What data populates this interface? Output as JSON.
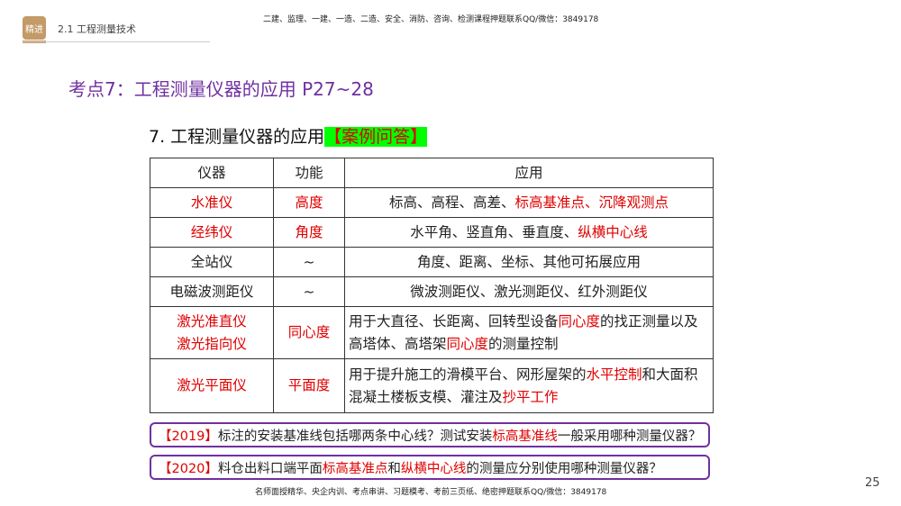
{
  "header": {
    "badge": "精进",
    "section": "2.1 工程测量技术",
    "top_note": "二建、监理、一建、一造、二造、安全、消防、咨询、检测课程押题联系QQ/微信：3849178"
  },
  "title": "考点7：工程测量仪器的应用  P27~28",
  "subtitle": {
    "text": "7. 工程测量仪器的应用",
    "highlight": "【案例问答】"
  },
  "table": {
    "headers": [
      "仪器",
      "功能",
      "应用"
    ],
    "rows": [
      {
        "instrument": [
          {
            "t": "水准仪",
            "red": true
          }
        ],
        "function": [
          {
            "t": "高度",
            "red": true
          }
        ],
        "application": [
          {
            "t": "标高、高程、高差、"
          },
          {
            "t": "标高基准点、沉降观测点",
            "red": true
          }
        ]
      },
      {
        "instrument": [
          {
            "t": "经纬仪",
            "red": true
          }
        ],
        "function": [
          {
            "t": "角度",
            "red": true
          }
        ],
        "application": [
          {
            "t": "水平角、竖直角、垂直度、"
          },
          {
            "t": "纵横中心线",
            "red": true
          }
        ]
      },
      {
        "instrument": [
          {
            "t": "全站仪"
          }
        ],
        "function": [
          {
            "t": "~"
          }
        ],
        "application": [
          {
            "t": "角度、距离、坐标、其他可拓展应用"
          }
        ]
      },
      {
        "instrument": [
          {
            "t": "电磁波测距仪"
          }
        ],
        "function": [
          {
            "t": "~"
          }
        ],
        "application": [
          {
            "t": "微波测距仪、激光测距仪、红外测距仪"
          }
        ]
      },
      {
        "instrument": [
          {
            "t": "激光准直仪",
            "red": true,
            "br": true
          },
          {
            "t": "激光指向仪",
            "red": true
          }
        ],
        "function": [
          {
            "t": "同心度",
            "red": true
          }
        ],
        "application": [
          {
            "t": "用于大直径、长距离、回转型设备"
          },
          {
            "t": "同心度",
            "red": true
          },
          {
            "t": "的找正测量以及高塔体、高塔架"
          },
          {
            "t": "同心度",
            "red": true
          },
          {
            "t": "的测量控制"
          }
        ]
      },
      {
        "instrument": [
          {
            "t": "激光平面仪",
            "red": true
          }
        ],
        "function": [
          {
            "t": "平面度",
            "red": true
          }
        ],
        "application": [
          {
            "t": "用于提升施工的滑模平台、网形屋架的"
          },
          {
            "t": "水平控制",
            "red": true
          },
          {
            "t": "和大面积混凝土楼板支模、灌注及"
          },
          {
            "t": "抄平工作",
            "red": true
          }
        ]
      }
    ]
  },
  "questions": [
    [
      {
        "t": "【2019】",
        "red": true
      },
      {
        "t": "标注的安装基准线包括哪两条中心线？测试安装"
      },
      {
        "t": "标高基准线",
        "red": true
      },
      {
        "t": "一般采用哪种测量仪器？"
      }
    ],
    [
      {
        "t": "【2020】",
        "red": true
      },
      {
        "t": "料仓出料口端平面"
      },
      {
        "t": "标高基准点",
        "red": true
      },
      {
        "t": "和"
      },
      {
        "t": "纵横中心线",
        "red": true
      },
      {
        "t": "的测量应分别使用哪种测量仪器？"
      }
    ]
  ],
  "footer": "名师面授精华、央企内训、考点串讲、习题模考、考前三页纸、绝密押题联系QQ/微信：3849178",
  "page_number": "25",
  "colors": {
    "accent": "#7030a0",
    "red": "#e00000",
    "highlight": "#00ff00",
    "badge": "#c49a66"
  }
}
